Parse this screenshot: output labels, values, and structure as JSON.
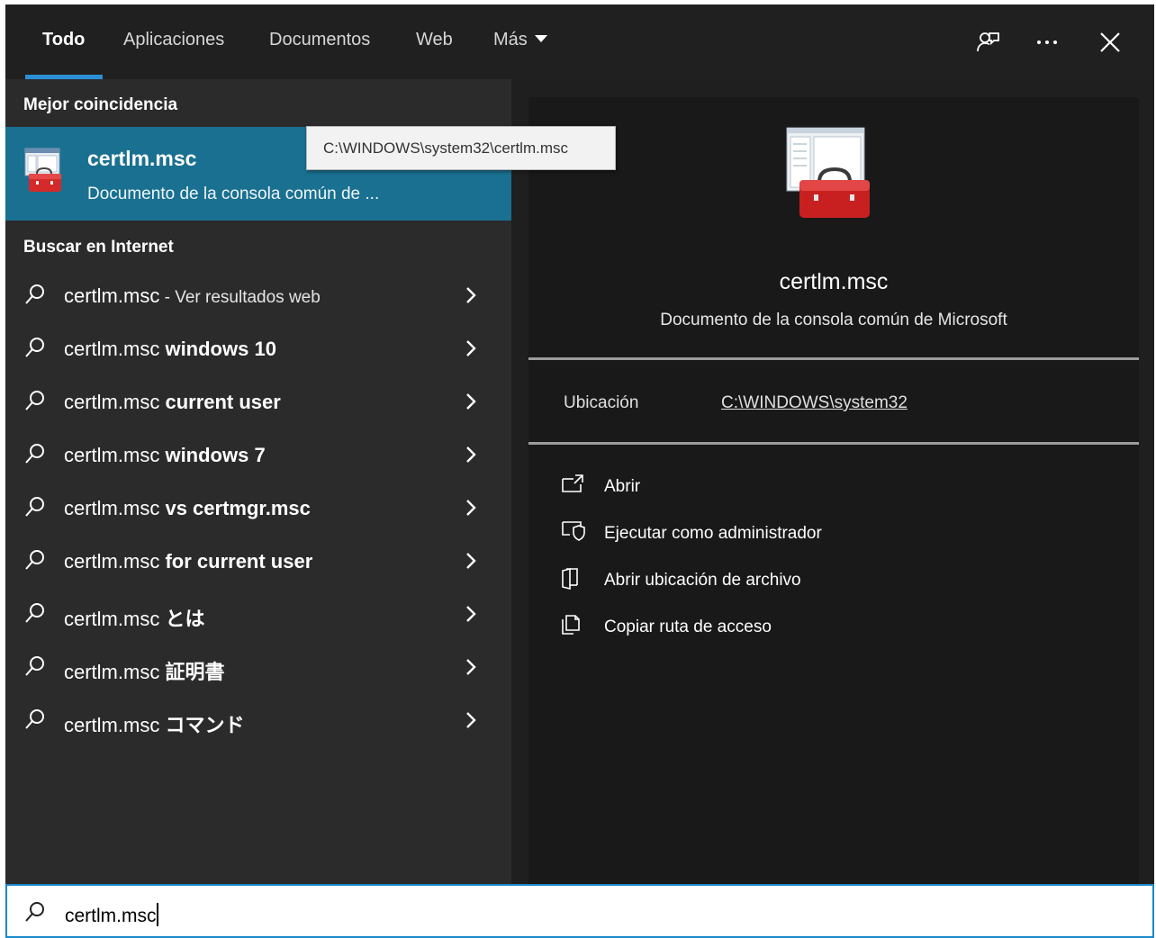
{
  "tabs": {
    "items": [
      "Todo",
      "Aplicaciones",
      "Documentos",
      "Web",
      "Más"
    ],
    "active": "Todo"
  },
  "toolbar": {
    "feedback_icon": "feedback-person-icon",
    "more_icon": "ellipsis-icon",
    "close_icon": "close-icon"
  },
  "left": {
    "best_match_heading": "Mejor coincidencia",
    "best_match": {
      "title": "certlm.msc",
      "subtitle": "Documento de la consola común de ...",
      "icon": "mmc-toolbox-icon",
      "tooltip": "C:\\WINDOWS\\system32\\certlm.msc"
    },
    "internet_heading": "Buscar en Internet",
    "suggestions": [
      {
        "prefix": "certlm.msc",
        "suffix": " - Ver resultados web"
      },
      {
        "prefix": "certlm.msc ",
        "suffix": "windows 10"
      },
      {
        "prefix": "certlm.msc ",
        "suffix": "current user"
      },
      {
        "prefix": "certlm.msc ",
        "suffix": "windows 7"
      },
      {
        "prefix": "certlm.msc ",
        "suffix": "vs certmgr.msc"
      },
      {
        "prefix": "certlm.msc ",
        "suffix": "for current user"
      },
      {
        "prefix": "certlm.msc ",
        "suffix": "とは"
      },
      {
        "prefix": "certlm.msc ",
        "suffix": "証明書"
      },
      {
        "prefix": "certlm.msc ",
        "suffix": "コマンド"
      }
    ]
  },
  "preview": {
    "title": "certlm.msc",
    "subtitle": "Documento de la consola común de Microsoft",
    "location_label": "Ubicación",
    "location_value": "C:\\WINDOWS\\system32",
    "actions": [
      {
        "label": "Abrir",
        "icon": "open-icon"
      },
      {
        "label": "Ejecutar como administrador",
        "icon": "run-as-admin-icon"
      },
      {
        "label": "Abrir ubicación de archivo",
        "icon": "file-location-icon"
      },
      {
        "label": "Copiar ruta de acceso",
        "icon": "copy-path-icon"
      }
    ]
  },
  "search": {
    "value": "certlm.msc"
  },
  "colors": {
    "accent": "#1a7090",
    "highlight": "#2b8fd6",
    "panel_left": "#2b2b2b",
    "panel_right": "#191919"
  }
}
